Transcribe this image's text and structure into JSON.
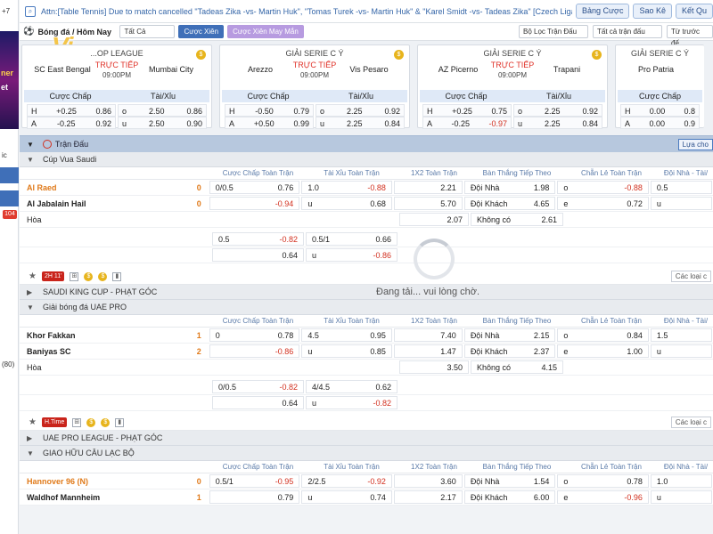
{
  "left_strip": {
    "top_text": "+7",
    "mid_text1": "ic",
    "mid_text2": "(80)",
    "badge": "104",
    "promo1": "ner",
    "promo2": "et"
  },
  "topbar": {
    "marquee": "Attn:[Table Tennis] Due to match cancelled \"Tadeas Zika -vs- Martin Huk\", \"Tomas Turek -vs- Martin Huk\" & \"Karel Smidt -vs- Tadeas Zika\" [Czech Liga Pro",
    "btn1": "Bảng Cược",
    "btn2": "Sao Kê",
    "btn3": "Kết Qu"
  },
  "filterbar": {
    "sport": "Bóng đá / Hôm Nay",
    "select": "Tất Cả",
    "chip1": "Cược Xiên",
    "chip2": "Cược Xiên May Mắn",
    "f1": "Bộ Lọc Trận Đấu",
    "f2": "Tất cả trận đấu",
    "f3": "Từ trước đế"
  },
  "logo": "Vi",
  "cards": [
    {
      "league": "...OP LEAGUE",
      "home": "SC East Bengal",
      "away": "Mumbai City",
      "live": "TRỰC TIẾP",
      "time": "09:00PM",
      "hc_head": "Cược Chấp",
      "ou_head": "Tài/Xỉu",
      "rows": [
        {
          "hl": "H",
          "hv": "+0.25",
          "ho": "0.86",
          "ol": "o",
          "ov": "2.50",
          "oo": "0.86"
        },
        {
          "hl": "A",
          "hv": "-0.25",
          "ho": "0.92",
          "ol": "u",
          "ov": "2.50",
          "oo": "0.90"
        }
      ]
    },
    {
      "league": "GIẢI SERIE C Ý",
      "home": "Arezzo",
      "away": "Vis Pesaro",
      "live": "TRỰC TIẾP",
      "time": "09:00PM",
      "hc_head": "Cược Chấp",
      "ou_head": "Tài/Xỉu",
      "rows": [
        {
          "hl": "H",
          "hv": "-0.50",
          "ho": "0.79",
          "ol": "o",
          "ov": "2.25",
          "oo": "0.92"
        },
        {
          "hl": "A",
          "hv": "+0.50",
          "ho": "0.99",
          "ol": "u",
          "ov": "2.25",
          "oo": "0.84"
        }
      ]
    },
    {
      "league": "GIẢI SERIE C Ý",
      "home": "AZ Picerno",
      "away": "Trapani",
      "live": "TRỰC TIẾP",
      "time": "09:00PM",
      "hc_head": "Cược Chấp",
      "ou_head": "Tài/Xỉu",
      "rows": [
        {
          "hl": "H",
          "hv": "+0.25",
          "ho": "0.75",
          "ol": "o",
          "ov": "2.25",
          "oo": "0.92"
        },
        {
          "hl": "A",
          "hv": "-0.25",
          "ho": "-0.97",
          "ol": "u",
          "ov": "2.25",
          "oo": "0.84"
        }
      ]
    },
    {
      "league": "GIẢI SERIE C Ý",
      "home": "Pro Patria",
      "away": "",
      "live": "",
      "time": "",
      "hc_head": "Cược Chấp",
      "ou_head": "",
      "rows": [
        {
          "hl": "H",
          "hv": "0.00",
          "ho": "0.8",
          "ol": "",
          "ov": "",
          "oo": ""
        },
        {
          "hl": "A",
          "hv": "0.00",
          "ho": "0.9",
          "ol": "",
          "ov": "",
          "oo": ""
        }
      ]
    }
  ],
  "section": {
    "title": "Trận Đấu",
    "filter_btn": "Lựa cho"
  },
  "columns": {
    "c1": "Cược Chấp Toàn Trận",
    "c2": "Tài Xỉu Toàn Trận",
    "c3": "1X2 Toàn Trận",
    "c4": "Bàn Thắng Tiếp Theo",
    "c5": "Chẵn Lẻ Toàn Trận",
    "c6": "Đội Nhà - Tài/"
  },
  "groups": {
    "g1": "Cúp Vua Saudi",
    "g2": "SAUDI KING CUP - PHẠT GÓC",
    "g3": "Giải bóng đá UAE PRO",
    "g4": "UAE PRO LEAGUE - PHẠT GÓC",
    "g5": "GIAO HỮU CÂU LẠC BỘ"
  },
  "m1": {
    "home": "Al Raed",
    "home_score": "0",
    "away": "Al Jabalain Hail",
    "away_score": "0",
    "draw": "Hòa",
    "r1": {
      "hc": "0/0.5",
      "hco": "0.76",
      "ou": "1.0",
      "ouo": "-0.88",
      "x": "2.21",
      "btl": "Đội Nhà",
      "bto": "1.98",
      "cel": "o",
      "ceo": "-0.88",
      "dn": "0.5"
    },
    "r2": {
      "hco": "-0.94",
      "oul": "u",
      "ouo": "0.68",
      "x": "5.70",
      "btl": "Đội Khách",
      "bto": "4.65",
      "cel": "e",
      "ceo": "0.72",
      "dn": "u"
    },
    "r3": {
      "x": "2.07",
      "btl": "Không có",
      "bto": "2.61"
    },
    "r4": {
      "hc": "0.5",
      "hco": "-0.82",
      "ou": "0.5/1",
      "ouo": "0.66"
    },
    "r5": {
      "hco": "0.64",
      "oul": "u",
      "ouo": "-0.86"
    },
    "badge": "2H 11'",
    "more": "Các loại c"
  },
  "m2": {
    "home": "Khor Fakkan",
    "home_score": "1",
    "away": "Baniyas SC",
    "away_score": "2",
    "draw": "Hòa",
    "r1": {
      "hc": "0",
      "hco": "0.78",
      "ou": "4.5",
      "ouo": "0.95",
      "x": "7.40",
      "btl": "Đội Nhà",
      "bto": "2.15",
      "cel": "o",
      "ceo": "0.84",
      "dn": "1.5"
    },
    "r2": {
      "hco": "-0.86",
      "oul": "u",
      "ouo": "0.85",
      "x": "1.47",
      "btl": "Đội Khách",
      "bto": "2.37",
      "cel": "e",
      "ceo": "1.00",
      "dn": "u"
    },
    "r3": {
      "x": "3.50",
      "btl": "Không có",
      "bto": "4.15"
    },
    "r4": {
      "hc": "0/0.5",
      "hco": "-0.82",
      "ou": "4/4.5",
      "ouo": "0.62"
    },
    "r5": {
      "hco": "0.64",
      "oul": "u",
      "ouo": "-0.82"
    },
    "badge": "H.Time",
    "more": "Các loại c"
  },
  "m3": {
    "home": "Hannover 96 (N)",
    "home_score": "0",
    "away": "Waldhof Mannheim",
    "away_score": "1",
    "r1": {
      "hc": "0.5/1",
      "hco": "-0.95",
      "ou": "2/2.5",
      "ouo": "-0.92",
      "x": "3.60",
      "btl": "Đội Nhà",
      "bto": "1.54",
      "cel": "o",
      "ceo": "0.78",
      "dn": "1.0"
    },
    "r2": {
      "hco": "0.79",
      "oul": "u",
      "ouo": "0.74",
      "x": "2.17",
      "btl": "Đội Khách",
      "bto": "6.00",
      "cel": "e",
      "ceo": "-0.96",
      "dn": "u"
    }
  },
  "loading": "Đang tải... vui lòng chờ."
}
